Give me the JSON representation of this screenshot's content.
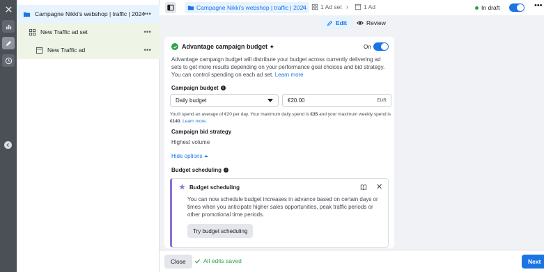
{
  "tree": {
    "campaign": "Campagne Nikki's webshop | traffic | 2024",
    "adset": "New Traffic ad set",
    "ad": "New Traffic ad",
    "more": "•••"
  },
  "topbar": {
    "campaign_crumb": "Campagne Nikki's webshop | traffic | 2024",
    "adset_crumb": "1 Ad set",
    "ad_crumb": "1 Ad",
    "status": "In draft",
    "more": "•••"
  },
  "tabs": {
    "edit": "Edit",
    "review": "Review"
  },
  "advantage": {
    "title": "Advantage campaign budget",
    "spark": "✦",
    "on_label": "On",
    "description": "Advantage campaign budget will distribute your budget across currently delivering ad sets to get more results depending on your performance goal choices and bid strategy. You can control spending on each ad set.",
    "learn_more": "Learn more"
  },
  "budget": {
    "label": "Campaign budget",
    "type_value": "Daily budget",
    "amount_value": "€20.00",
    "currency": "EUR",
    "spend_note_1": "You'll spend an average of €20 per day. Your maximum daily spend is ",
    "spend_max_daily": "€35",
    "spend_note_2": " and your maximum weekly spend is ",
    "spend_max_weekly": "€140",
    "spend_note_3": ".",
    "spend_learn_more": "Learn more."
  },
  "bid": {
    "label": "Campaign bid strategy",
    "value": "Highest volume"
  },
  "hide_options": "Hide options",
  "scheduling": {
    "label": "Budget scheduling",
    "box_title": "Budget scheduling",
    "text": "You can now schedule budget increases in advance based on certain days or times when you anticipate higher sales opportunities, peak traffic periods or other promotional time periods.",
    "button": "Try budget scheduling",
    "close": "✕"
  },
  "footer": {
    "close": "Close",
    "saved": "All edits saved",
    "next": "Next"
  },
  "colors": {
    "accent": "#1b74e4",
    "success": "#31a24c",
    "rail": "#4b4f56",
    "schedule_accent": "#8a6fd6"
  }
}
